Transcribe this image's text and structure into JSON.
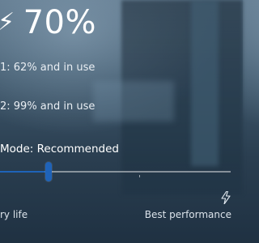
{
  "battery": {
    "overall": "70%",
    "overall_icon": "plug-icon",
    "battery1": "1: 62% and in use",
    "battery2": "2: 99% and in use"
  },
  "power_mode": {
    "label": "Mode: Recommended",
    "slider_value_percent": 21,
    "left_label": "ry life",
    "right_label": "Best performance",
    "right_icon": "lightning-bolt-icon",
    "accent_color": "#1f63b8"
  }
}
